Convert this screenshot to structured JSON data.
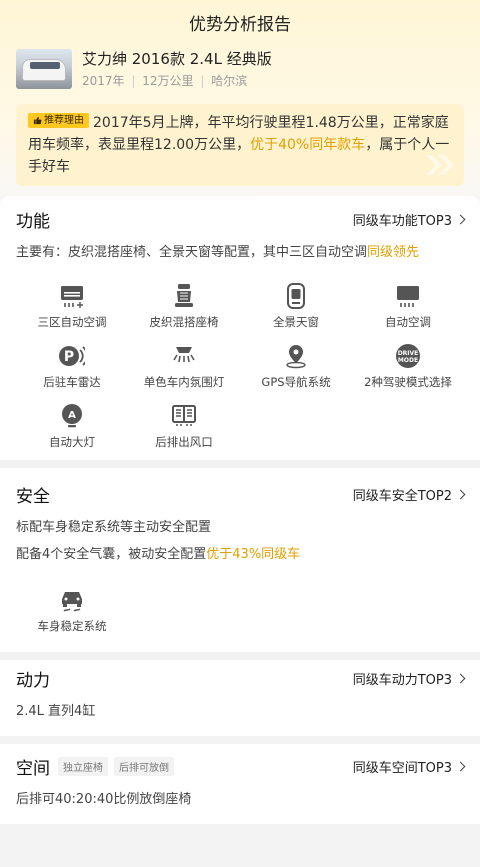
{
  "header": {
    "title": "优势分析报告"
  },
  "car": {
    "name": "艾力绅 2016款 2.4L 经典版",
    "year": "2017年",
    "mileage": "12万公里",
    "city": "哈尔滨",
    "sep": "|"
  },
  "reason": {
    "badge": "推荐理由",
    "text_before": "2017年5月上牌，年平均行驶里程1.48万公里，正常家庭用车频率，表显里程12.00万公里，",
    "highlight": "优于40%同年款车",
    "text_after": "，属于个人一手好车"
  },
  "function": {
    "title": "功能",
    "link": "同级车功能TOP3",
    "desc_before": "主要有：皮织混搭座椅、全景天窗等配置，其中三区自动空调",
    "desc_highlight": "同级领先",
    "features": [
      {
        "label": "三区自动空调",
        "icon": "ac-vent-icon"
      },
      {
        "label": "皮织混搭座椅",
        "icon": "seat-icon"
      },
      {
        "label": "全景天窗",
        "icon": "sunroof-icon"
      },
      {
        "label": "自动空调",
        "icon": "auto-ac-icon"
      },
      {
        "label": "后驻车雷达",
        "icon": "parking-radar-icon"
      },
      {
        "label": "单色车内氛围灯",
        "icon": "ambient-light-icon"
      },
      {
        "label": "GPS导航系统",
        "icon": "gps-icon"
      },
      {
        "label": "2种驾驶模式选择",
        "icon": "drive-mode-icon"
      },
      {
        "label": "自动大灯",
        "icon": "auto-headlight-icon"
      },
      {
        "label": "后排出风口",
        "icon": "rear-vent-icon"
      }
    ],
    "drive_mode_text": [
      "DRIVE",
      "MODE"
    ],
    "headlight_letter": "A",
    "parking_letter": "P"
  },
  "safety": {
    "title": "安全",
    "link": "同级车安全TOP2",
    "line1": "标配车身稳定系统等主动安全配置",
    "line2_before": "配备4个安全气囊，被动安全配置",
    "line2_highlight": "优于43%同级车",
    "features": [
      {
        "label": "车身稳定系统",
        "icon": "stability-control-icon"
      }
    ]
  },
  "power": {
    "title": "动力",
    "link": "同级车动力TOP3",
    "desc": "2.4L 直列4缸"
  },
  "space": {
    "title": "空间",
    "tags": [
      "独立座椅",
      "后排可放倒"
    ],
    "link": "同级车空间TOP3",
    "desc": "后排可40:20:40比例放倒座椅"
  },
  "colors": {
    "accent": "#e0a100",
    "badge": "#ffc81e",
    "hero_bg": "#fff6d6"
  }
}
